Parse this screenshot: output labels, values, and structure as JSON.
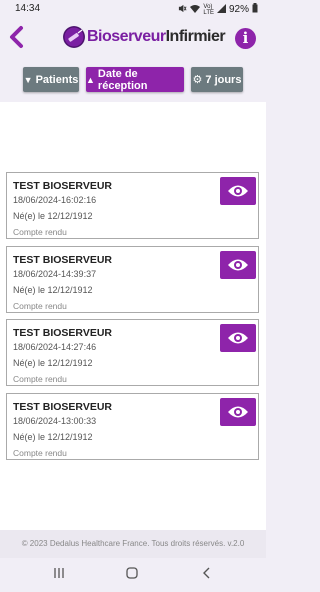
{
  "status_bar": {
    "time": "14:34",
    "battery": "92%",
    "icons": [
      "mute-icon",
      "wifi-icon",
      "volte-icon",
      "signal-icon",
      "battery-icon"
    ]
  },
  "header": {
    "logo_part1": "Bioserveur",
    "logo_part2": "Infirmier",
    "info_label": "i"
  },
  "filters": {
    "patients": "Patients",
    "date": "Date de réception",
    "days": "7 jours"
  },
  "records": [
    {
      "name": "TEST BIOSERVEUR",
      "date": "18/06/2024-16:02:16",
      "birth": "Né(e) le 12/12/1912",
      "status": "Compte rendu"
    },
    {
      "name": "TEST BIOSERVEUR",
      "date": "18/06/2024-14:39:37",
      "birth": "Né(e) le 12/12/1912",
      "status": "Compte rendu"
    },
    {
      "name": "TEST BIOSERVEUR",
      "date": "18/06/2024-14:27:46",
      "birth": "Né(e) le 12/12/1912",
      "status": "Compte rendu"
    },
    {
      "name": "TEST BIOSERVEUR",
      "date": "18/06/2024-13:00:33",
      "birth": "Né(e) le 12/12/1912",
      "status": "Compte rendu"
    }
  ],
  "footer": "© 2023 Dedalus Healthcare France. Tous droits réservés. v.2.0",
  "colors": {
    "accent": "#8e24aa",
    "secondary": "#6c7a7f",
    "background": "#f1eef6"
  }
}
